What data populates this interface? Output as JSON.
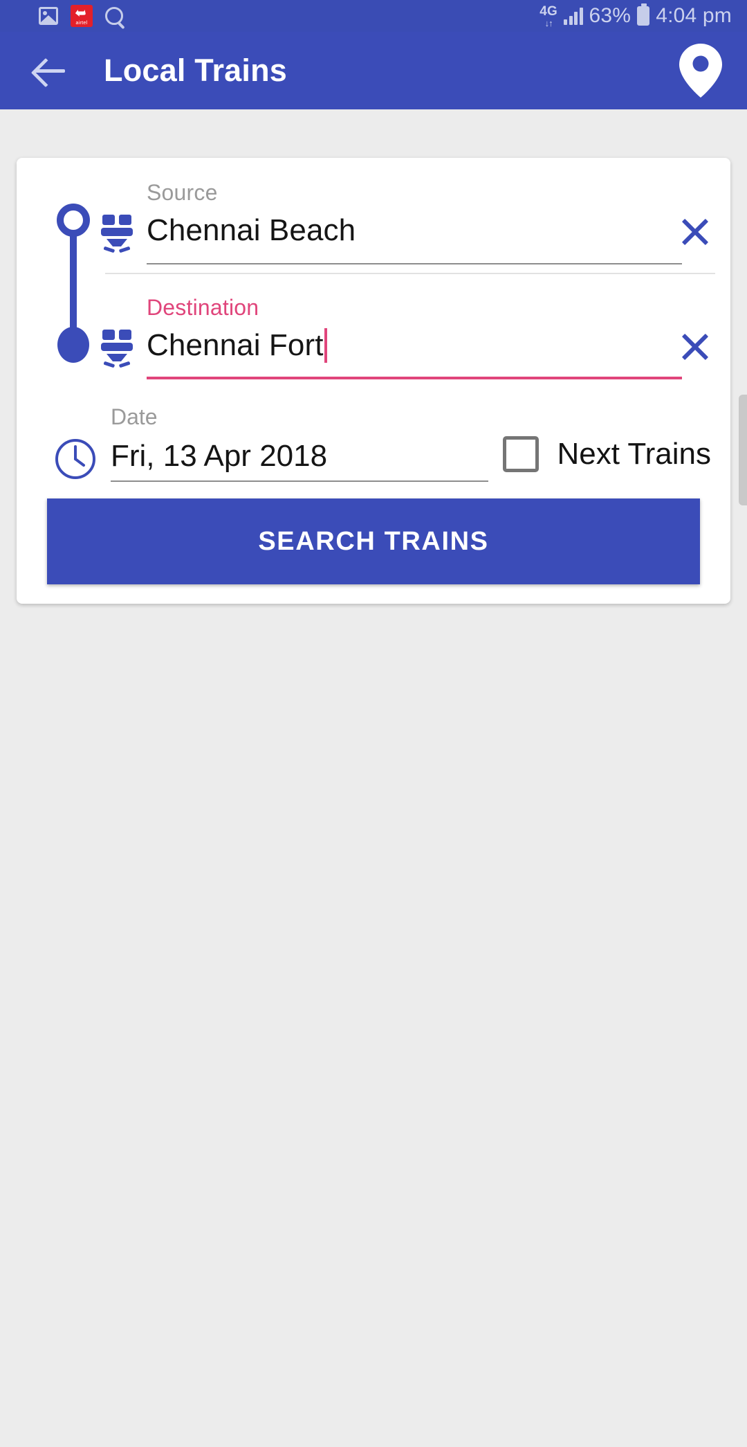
{
  "status_bar": {
    "icons": [
      "gallery-icon",
      "airtel-icon",
      "search-icon"
    ],
    "airtel_label": "airtel",
    "network_type": "4G",
    "data_arrows": "↓↑",
    "battery_percent": "63%",
    "time": "4:04 pm",
    "background_color": "#3a4cb4",
    "text_color": "#ccd2ee"
  },
  "app_bar": {
    "back_label": "back-arrow",
    "title": "Local Trains",
    "action_icon": "location-pin-icon",
    "background_color": "#3b4cb8",
    "title_color": "#ffffff"
  },
  "form": {
    "source": {
      "label": "Source",
      "value": "Chennai Beach",
      "placeholder": "Source",
      "clear_label": "✕",
      "marker": "hollow-circle",
      "icon": "train-icon",
      "focused": false,
      "label_color": "#9a9a9a",
      "underline_color": "#8d8d8d"
    },
    "destination": {
      "label": "Destination",
      "value": "Chennai Fort",
      "placeholder": "Destination",
      "clear_label": "✕",
      "marker": "filled-circle",
      "icon": "train-icon",
      "focused": true,
      "label_color": "#e0457b",
      "underline_color": "#e0457b"
    },
    "date": {
      "label": "Date",
      "value": "Fri, 13 Apr 2018",
      "icon": "clock-icon"
    },
    "next_trains": {
      "label": "Next Trains",
      "checked": false
    },
    "search_button": {
      "label": "SEARCH TRAINS",
      "background_color": "#3b4cb8",
      "text_color": "#ffffff"
    }
  },
  "colors": {
    "primary": "#3b4cb8",
    "accent_pink": "#e0457b",
    "page_background": "#ececec",
    "card_background": "#ffffff"
  }
}
